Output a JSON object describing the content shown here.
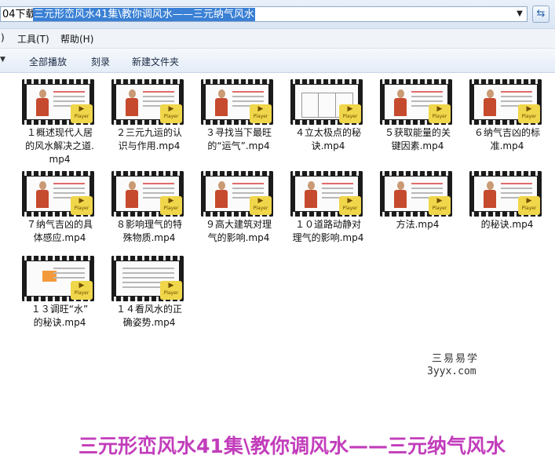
{
  "address": {
    "prefix": "04下载\\",
    "selected": "三元形峦风水41集\\教你调风水——三元纳气风水",
    "dropdown_icon": "chevron-down-icon",
    "refresh_icon": "refresh-icon"
  },
  "menu": {
    "m0": ")",
    "m1": "工具(T)",
    "m2": "帮助(H)"
  },
  "toolbar": {
    "play_all": "全部播放",
    "burn": "刻录",
    "new_folder": "新建文件夹"
  },
  "files": [
    {
      "l1": "１概述现代人居",
      "l2": "的风水解决之道.",
      "l3": "mp4"
    },
    {
      "l1": "２三元九运的认",
      "l2": "识与作用.mp4",
      "l3": ""
    },
    {
      "l1": "３寻找当下最旺",
      "l2": "的“运气”.mp4",
      "l3": ""
    },
    {
      "l1": "４立太极点的秘",
      "l2": "诀.mp4",
      "l3": ""
    },
    {
      "l1": "５获取能量的关",
      "l2": "键因素.mp4",
      "l3": ""
    },
    {
      "l1": "６纳气吉凶的标",
      "l2": "准.mp4",
      "l3": ""
    },
    {
      "l1": "７纳气吉凶的具",
      "l2": "体感应.mp4",
      "l3": ""
    },
    {
      "l1": "８影响理气的特",
      "l2": "殊物质.mp4",
      "l3": ""
    },
    {
      "l1": "９高大建筑对理",
      "l2": "气的影响.mp4",
      "l3": ""
    },
    {
      "l1": "１０道路动静对",
      "l2": "理气的影响.mp4",
      "l3": ""
    },
    {
      "l1": "",
      "l2": "方法.mp4",
      "l3": ""
    },
    {
      "l1": "",
      "l2": "的秘诀.mp4",
      "l3": ""
    },
    {
      "l1": "１３调旺“水”",
      "l2": "的秘诀.mp4",
      "l3": ""
    },
    {
      "l1": "１４看风水的正",
      "l2": "确姿势.mp4",
      "l3": ""
    }
  ],
  "badge_label": "Player",
  "watermark": {
    "title": "三易易学",
    "site": "3yyx.com"
  },
  "caption": "三元形峦风水41集\\教你调风水——三元纳气风水"
}
